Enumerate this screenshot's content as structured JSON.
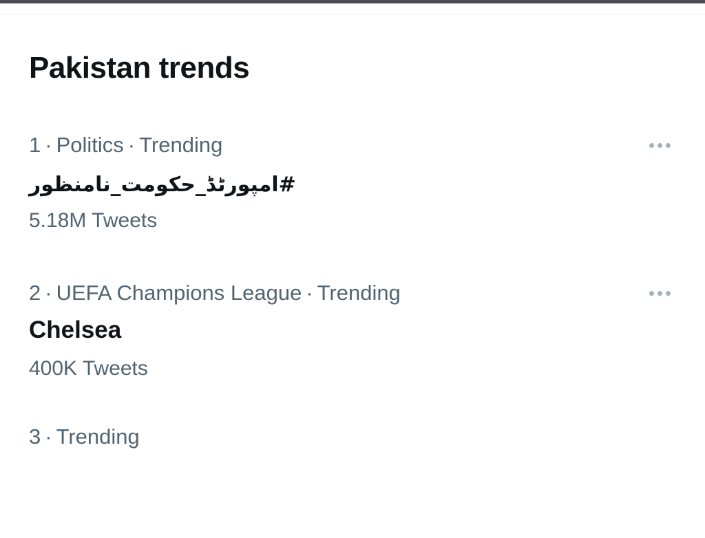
{
  "section": {
    "title": "Pakistan trends"
  },
  "trends": [
    {
      "rank": "1",
      "category": "Politics",
      "status": "Trending",
      "name": "#امپورٹڈ_حکومت_نامنظور",
      "count": "5.18M Tweets"
    },
    {
      "rank": "2",
      "category": "UEFA Champions League",
      "status": "Trending",
      "name": "Chelsea",
      "count": "400K Tweets"
    },
    {
      "rank": "3",
      "category": "Trending",
      "status": "",
      "name": "",
      "count": ""
    }
  ],
  "meta_separator": "·",
  "icons": {
    "more": "more-horizontal-icon"
  },
  "colors": {
    "text_primary": "#0f1419",
    "text_secondary": "#536471",
    "icon_muted": "#a7b1b9"
  }
}
